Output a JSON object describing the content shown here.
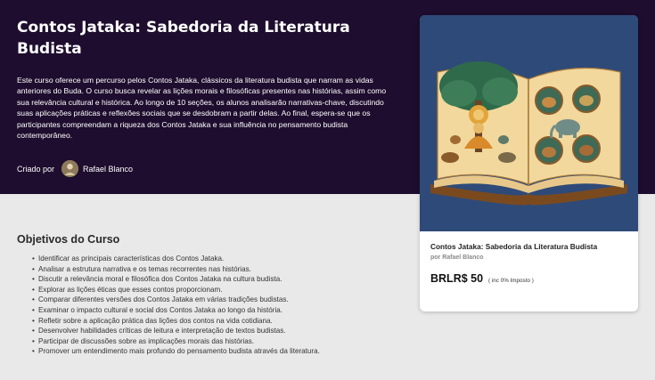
{
  "course": {
    "title": "Contos Jataka: Sabedoria da Literatura Budista",
    "description": "Este curso oferece um percurso pelos Contos Jataka, clássicos da literatura budista que narram as vidas anteriores do Buda. O curso busca revelar as lições morais e filosóficas presentes nas histórias, assim como sua relevância cultural e histórica. Ao longo de 10 seções, os alunos analisarão narrativas-chave, discutindo suas aplicações práticas e reflexões sociais que se desdobram a partir delas. Ao final, espera-se que os participantes compreendam a riqueza dos Contos Jataka e sua influência no pensamento budista contemporâneo.",
    "created_by_label": "Criado por",
    "author": "Rafael Blanco"
  },
  "objectives": {
    "heading": "Objetivos do Curso",
    "items": [
      "Identificar as principais características dos Contos Jataka.",
      "Analisar a estrutura narrativa e os temas recorrentes nas histórias.",
      "Discutir a relevância moral e filosófica dos Contos Jataka na cultura budista.",
      "Explorar as lições éticas que esses contos proporcionam.",
      "Comparar diferentes versões dos Contos Jataka em várias tradições budistas.",
      "Examinar o impacto cultural e social dos Contos Jataka ao longo da história.",
      "Refletir sobre a aplicação prática das lições dos contos na vida cotidiana.",
      "Desenvolver habilidades críticas de leitura e interpretação de textos budistas.",
      "Participar de discussões sobre as implicações morais das histórias.",
      "Promover um entendimento mais profundo do pensamento budista através da literatura."
    ]
  },
  "card": {
    "title": "Contos Jataka: Sabedoria da Literatura Budista",
    "author": "por Rafael Blanco",
    "price": "BRLR$ 50",
    "tax_note": "( inc 0% Imposto )",
    "image_icon": "open-book-illustration"
  },
  "colors": {
    "hero_bg": "#1e0d2e",
    "page_bg": "#e9e9e9",
    "card_image_bg": "#2e4a78"
  }
}
